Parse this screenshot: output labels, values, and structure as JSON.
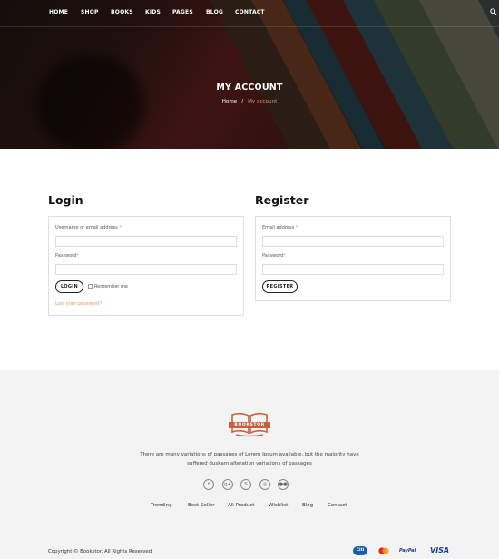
{
  "nav": {
    "items": [
      "HOME",
      "SHOP",
      "BOOKS",
      "KIDS",
      "PAGES",
      "BLOG",
      "CONTACT"
    ],
    "search_icon": "search-icon"
  },
  "hero": {
    "title": "MY ACCOUNT",
    "breadcrumb": {
      "home": "Home",
      "separator": "/",
      "current": "My account"
    }
  },
  "login": {
    "title": "Login",
    "username_label": "Username or email address",
    "password_label": "Password",
    "required_mark": "*",
    "button": "LOGIN",
    "remember": "Remember me",
    "lost_password": "Lost your password?"
  },
  "register": {
    "title": "Register",
    "email_label": "Email address",
    "password_label": "Password",
    "required_mark": "*",
    "button": "REGISTER"
  },
  "footer": {
    "logo_text": "BOOKSTOR",
    "description": "There are many variations of passages of Lorem Ipsum available, but the majority have suffered duskam alteration variations of passages",
    "social_icons": [
      "facebook-icon",
      "google-plus-icon",
      "skype-icon",
      "flickr-icon"
    ],
    "links": [
      "Trending",
      "Best Seller",
      "All Product",
      "Wishlist",
      "Blog",
      "Contact"
    ],
    "copyright": "Copyright © Bookstor. All Rights Reserved",
    "payments": {
      "card1": "Citi",
      "card3": "PayPal",
      "card4": "VISA"
    }
  },
  "colors": {
    "accent": "#e8936a",
    "logo": "#c8603c",
    "footer_bg": "#f3f3f3"
  }
}
